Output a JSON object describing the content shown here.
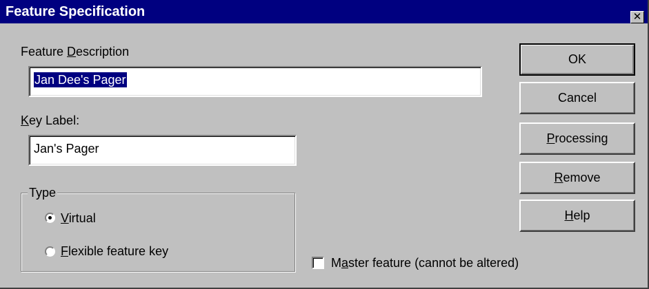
{
  "window": {
    "title": "Feature Specification",
    "close_glyph": "✕",
    "colors": {
      "titlebar": "#000080",
      "face": "#c0c0c0",
      "selection": "#000080"
    }
  },
  "feature_description": {
    "label_pre": "Feature ",
    "label_mnemonic": "D",
    "label_post": "escription",
    "value": "Jan Dee's Pager"
  },
  "key_label": {
    "label_mnemonic": "K",
    "label_post": "ey Label:",
    "value": "Jan's Pager"
  },
  "type_group": {
    "legend": "Type",
    "options": [
      {
        "mnemonic": "V",
        "rest": "irtual",
        "selected": true
      },
      {
        "mnemonic": "F",
        "rest": "lexible feature key",
        "selected": false
      }
    ]
  },
  "master_feature": {
    "pre": "M",
    "mnemonic": "a",
    "rest": "ster feature (cannot be altered)",
    "checked": false
  },
  "buttons": {
    "ok": "OK",
    "cancel": "Cancel",
    "processing": {
      "mnemonic": "P",
      "rest": "rocessing"
    },
    "remove": {
      "mnemonic": "R",
      "rest": "emove"
    },
    "help": {
      "mnemonic": "H",
      "rest": "elp"
    }
  }
}
